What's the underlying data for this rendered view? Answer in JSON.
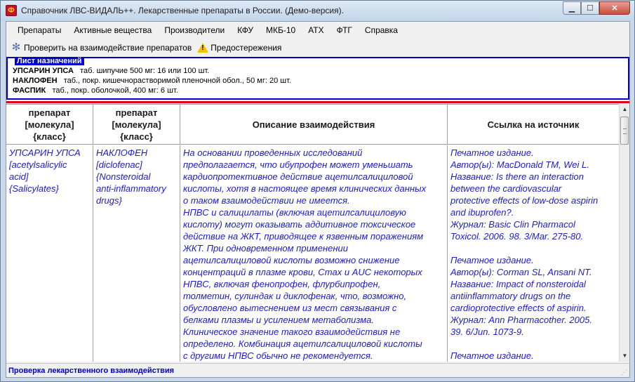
{
  "window": {
    "title": "Справочник ЛВС-ВИДАЛЬ++. Лекарственные препараты в России. (Демо-версия).",
    "app_icon_glyph": "Ф"
  },
  "menu": [
    "Препараты",
    "Активные вещества",
    "Производители",
    "КФУ",
    "МКБ-10",
    "АТХ",
    "ФТГ",
    "Справка"
  ],
  "toolbar": {
    "check_interaction": "Проверить на взаимодействие препаратов",
    "warnings": "Предостережения",
    "check_icon": "gear-icon",
    "warnings_icon": "warning-icon"
  },
  "prescription": {
    "legend": "Лист назначений",
    "items": [
      {
        "name": "УПСАРИН УПСА",
        "form": "таб. шипучие 500 мг: 16 или 100 шт."
      },
      {
        "name": "НАКЛОФЕН",
        "form": "таб., покр. кишечнорастворимой пленочной обол., 50 мг: 20 шт."
      },
      {
        "name": "ФАСПИК",
        "form": "таб., покр. оболочкой, 400 мг: 6 шт."
      }
    ]
  },
  "table": {
    "headers": {
      "col1": [
        "препарат",
        "[молекула]",
        "{класс}"
      ],
      "col2": [
        "препарат",
        "[молекула]",
        "{класс}"
      ],
      "col3": [
        "Описание взаимодействия"
      ],
      "col4": [
        "Ссылка на источник"
      ]
    },
    "row": {
      "drug1": [
        "УПСАРИН УПСА",
        " [acetylsalicylic",
        " acid]",
        " {Salicylates}"
      ],
      "drug2": [
        "НАКЛОФЕН",
        " [diclofenac]",
        " {Nonsteroidal",
        " anti-inflammatory",
        " drugs}"
      ],
      "description": [
        "На основании проведенных исследований",
        "предполагается, что ибупрофен может уменьшать",
        "кардиопротективное действие ацетилсалициловой",
        "кислоты, хотя в настоящее время клинических данных",
        "о таком взаимодействии не имеется.",
        "НПВС и салицилаты (включая ацетилсалициловую",
        "кислоту) могут оказывать аддитивное токсическое",
        "действие на ЖКТ, приводящее к язвенным поражениям",
        "ЖКТ. При одновременном применении",
        "ацетилсалициловой кислоты возможно снижение",
        "концентраций в плазме крови, Cmax и AUC некоторых",
        "НПВС, включая фенопрофен, флурбипрофен,",
        "толметин, сулиндак и диклофенак, что, возможно,",
        "обусловлено вытеснением из мест связывания с",
        "белками плазмы и усилением метаболизма.",
        "Клиническое значение такого взаимодействия не",
        "определено. Комбинация ацетилсалициловой кислоты",
        "с другими НПВС обычно не рекомендуется."
      ],
      "sources": [
        [
          "Печатное издание.",
          "Автор(ы): MacDonald TM, Wei L.",
          "Название: Is there an interaction",
          "between the cardiovascular",
          "protective effects of low-dose aspirin",
          "and ibuprofen?.",
          "Журнал: Basic Clin Pharmacol",
          "Toxicol. 2006. 98. 3/Mar. 275-80."
        ],
        [
          "Печатное издание.",
          "Автор(ы): Corman SL, Ansani NT.",
          "Название: Impact of nonsteroidal",
          "antiinflammatory drugs on the",
          "cardioprotective effects of aspirin.",
          "Журнал: Ann Pharmacother. 2005.",
          "39. 6/Jun. 1073-9."
        ],
        [
          "Печатное издание."
        ]
      ]
    }
  },
  "status": {
    "text": "Проверка лекарственного взаимодействия"
  },
  "colors": {
    "link_text": "#1c1cc8",
    "frame_blue": "#0000c8",
    "separator_red": "#e0001a",
    "status_text": "#0000c0"
  }
}
